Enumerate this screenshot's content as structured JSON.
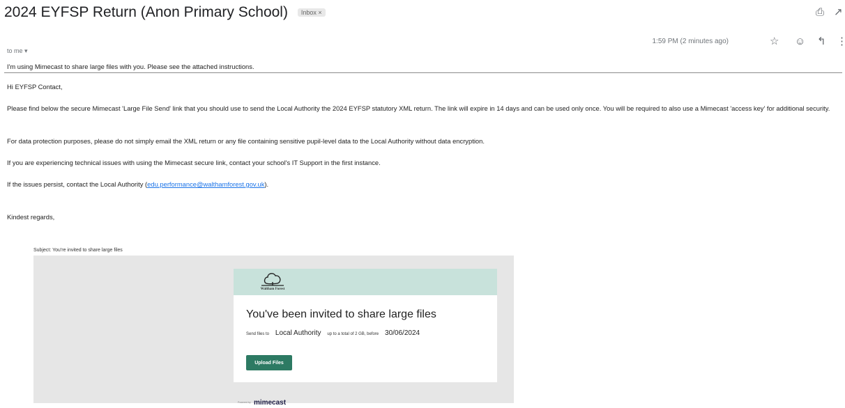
{
  "email": {
    "subject": "2024 EYFSP Return (Anon Primary School)",
    "label_chip": "Inbox ×",
    "timestamp": "1:59 PM (2 minutes ago)",
    "recipient": "to me ▾",
    "intro_line": "I'm using Mimecast to share large files with you. Please see the attached instructions.",
    "greeting": "Hi EYFSP Contact,",
    "paragraph_1": "Please find below the secure Mimecast 'Large File Send' link that you should use to send the Local Authority the 2024 EYFSP statutory XML return. The link will expire in 14 days and can be used only once. You will be required to also use a Mimecast 'access key' for additional security.",
    "paragraph_2": "For data protection purposes, please do not simply email the XML return or any file containing sensitive pupil-level data to the Local Authority without data encryption.",
    "paragraph_3": "If you are experiencing technical issues with using the Mimecast secure link, contact your school's IT Support in the first instance.",
    "paragraph_4_prefix": "If the issues persist, contact the Local Authority (",
    "contact_email": "edu.performance@walthamforest.gov.uk",
    "paragraph_4_suffix": ").",
    "signoff": "Kindest regards,"
  },
  "toolbar_icons": [
    "print-icon",
    "open-in-new-window-icon",
    "star-icon",
    "emoji-react-icon",
    "reply-icon",
    "more-options-icon"
  ],
  "forwarded": {
    "subject_line": "Subject: You're invited to share large files",
    "org_logo_text": "Waltham Forest",
    "title": "You've been invited to share large files",
    "send_files_to_label": "Send files to",
    "recipient": "Local Authority",
    "limit_text": "up to a total of 2 GB, before",
    "deadline": "30/06/2024",
    "upload_button": "Upload Files",
    "powered_by": "Powered by",
    "brand": "mimecast"
  },
  "colors": {
    "card_header": "#c8e2db",
    "upload_button": "#2d7a63",
    "link": "#1a73e8",
    "outer_background": "#e6e6e6"
  }
}
